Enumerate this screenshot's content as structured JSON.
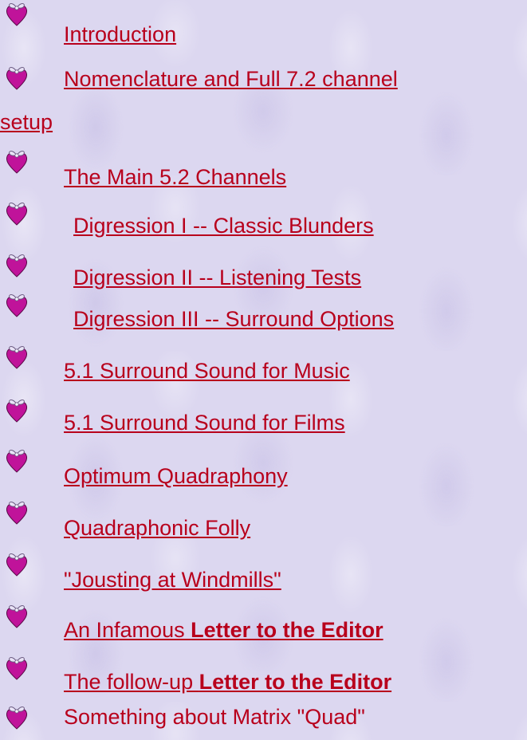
{
  "items": [
    {
      "text": "Introduction"
    },
    {
      "text": "Nomenclature and Full 7.2 channel",
      "continuation": "setup"
    },
    {
      "text": "The Main 5.2 Channels"
    },
    {
      "text": "Digression I -- Classic Blunders"
    },
    {
      "text": "Digression II -- Listening Tests"
    },
    {
      "text": "Digression III -- Surround Options"
    },
    {
      "text": "5.1 Surround Sound for Music"
    },
    {
      "text": "5.1 Surround Sound for Films"
    },
    {
      "text": "Optimum Quadraphony"
    },
    {
      "text": "Quadraphonic Folly"
    },
    {
      "text": "\"Jousting at Windmills\""
    },
    {
      "prefix": "An Infamous ",
      "bold": "Letter to the Editor"
    },
    {
      "prefix": "The follow-up ",
      "bold": "Letter to the Editor"
    },
    {
      "text": "Something about Matrix \"Quad\""
    }
  ],
  "colors": {
    "link": "#b8001c",
    "icon_body": "#c0139a",
    "icon_bow": "#e9e3f6"
  },
  "icon": "heart-with-bow-icon"
}
